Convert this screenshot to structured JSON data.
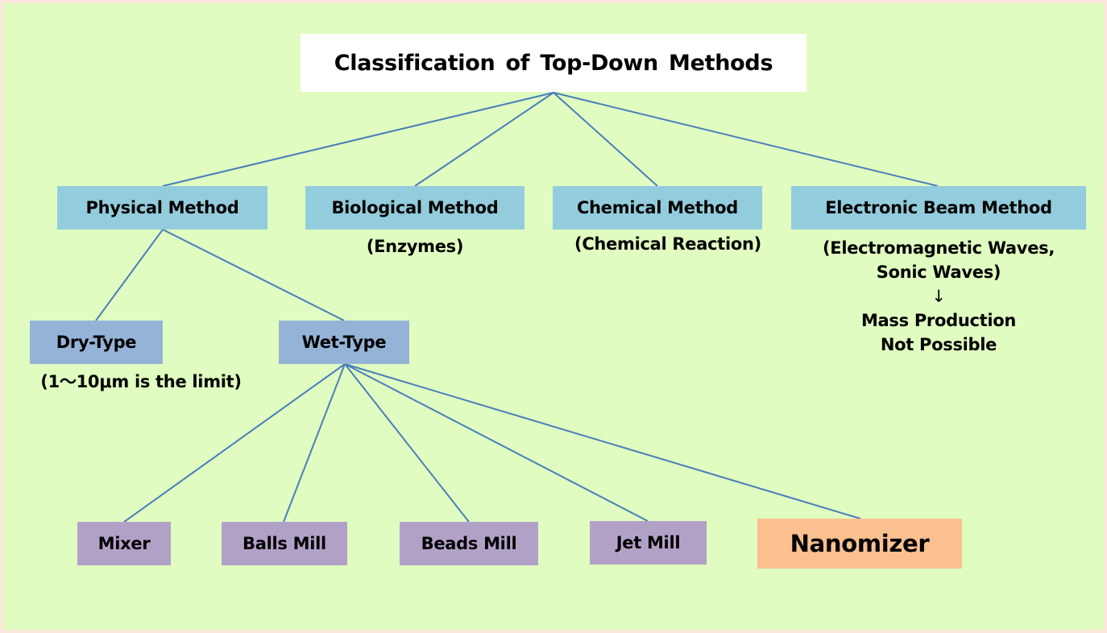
{
  "diagram": {
    "title": "Classification of Top-Down Methods",
    "methods": [
      {
        "label": "Physical Method",
        "note": ""
      },
      {
        "label": "Biological Method",
        "note": "(Enzymes)"
      },
      {
        "label": "Chemical Method",
        "note": "(Chemical Reaction)"
      },
      {
        "label": "Electronic Beam Method",
        "note_lines": [
          "(Electromagnetic Waves,",
          "Sonic Waves)",
          "↓",
          "Mass Production",
          "Not Possible"
        ]
      }
    ],
    "physical_types": [
      {
        "label": "Dry-Type",
        "note": "(1～10μm is the limit)"
      },
      {
        "label": "Wet-Type"
      }
    ],
    "wet_type_equipment": [
      {
        "label": "Mixer",
        "highlight": false
      },
      {
        "label": "Balls Mill",
        "highlight": false
      },
      {
        "label": "Beads Mill",
        "highlight": false
      },
      {
        "label": "Jet Mill",
        "highlight": false
      },
      {
        "label": "Nanomizer",
        "highlight": true
      }
    ],
    "colors": {
      "background": "#e0fcc0",
      "border": "#fde6dc",
      "title_box": "#ffffff",
      "method_box": "#93cddd",
      "type_box": "#95b3d7",
      "equipment_box": "#b2a1c7",
      "highlight_box": "#fac090",
      "connector": "#4a7ebb"
    }
  }
}
